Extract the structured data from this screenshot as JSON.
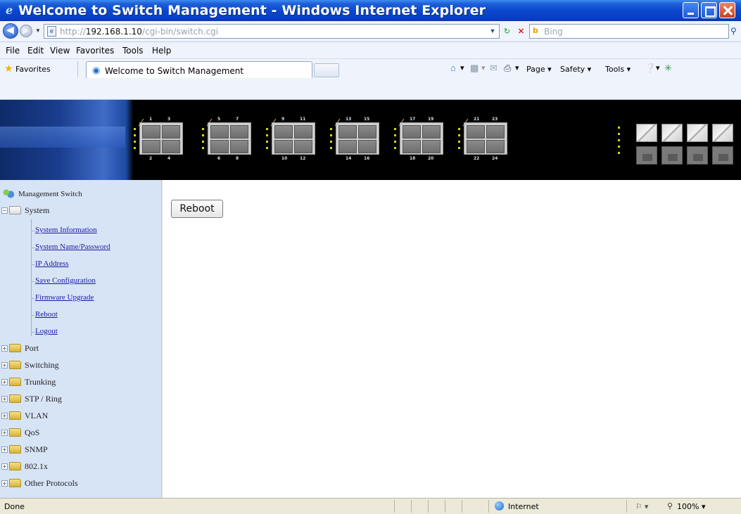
{
  "window": {
    "title": "Welcome to Switch Management - Windows Internet Explorer"
  },
  "address_bar": {
    "url_prefix": "http://",
    "url_host": "192.168.1.10",
    "url_path": "/cgi-bin/switch.cgi",
    "search_placeholder": "Bing"
  },
  "menu": [
    "File",
    "Edit",
    "View",
    "Favorites",
    "Tools",
    "Help"
  ],
  "favorites_bar": {
    "favorites_label": "Favorites",
    "tab_title": "Welcome to Switch Management",
    "commands": [
      "Page",
      "Safety",
      "Tools"
    ]
  },
  "sidebar": {
    "root_label": "Management Switch",
    "system_label": "System",
    "system_items": [
      "System Information",
      "System Name/Password",
      "IP Address",
      "Save Configuration",
      "Firmware Upgrade",
      "Reboot",
      "Logout"
    ],
    "folders": [
      "Port",
      "Switching",
      "Trunking",
      "STP / Ring",
      "VLAN",
      "QoS",
      "SNMP",
      "802.1x",
      "Other Protocols"
    ]
  },
  "content": {
    "reboot_button": "Reboot"
  },
  "status_bar": {
    "status": "Done",
    "zone": "Internet",
    "zoom": "100%"
  },
  "switch_panel": {
    "port_numbers": [
      [
        "1",
        "3",
        "2",
        "4"
      ],
      [
        "5",
        "7",
        "6",
        "8"
      ],
      [
        "9",
        "11",
        "10",
        "12"
      ],
      [
        "13",
        "15",
        "14",
        "16"
      ],
      [
        "17",
        "19",
        "18",
        "20"
      ],
      [
        "21",
        "23",
        "22",
        "24"
      ]
    ]
  },
  "colors": {
    "titlebar": "#0a48d0",
    "sidebar_bg": "#d7e4f6",
    "link": "#1a1aa6"
  }
}
